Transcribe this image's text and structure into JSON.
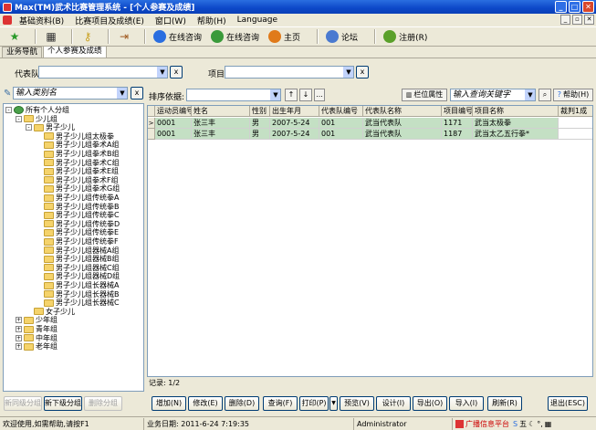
{
  "window": {
    "title": "Max(TM)武术比赛管理系统 - [个人参赛及成绩]"
  },
  "menu": {
    "items": [
      "基础资料(B)",
      "比赛项目及成绩(E)",
      "窗口(W)",
      "帮助(H)",
      "Language"
    ]
  },
  "toolbar": {
    "buttons": [
      {
        "label": "在线咨询",
        "icon": "headset-icon",
        "color": "#2a6ee0"
      },
      {
        "label": "在线咨询",
        "icon": "chat-icon",
        "color": "#3a9a3a"
      },
      {
        "label": "主页",
        "icon": "home-icon",
        "color": "#e07a1a"
      },
      {
        "label": "论坛",
        "icon": "forum-icon",
        "color": "#4a7ad0"
      },
      {
        "label": "注册(R)",
        "icon": "register-icon",
        "color": "#5aa02a"
      }
    ]
  },
  "tabs": [
    {
      "label": "业务导航",
      "active": false
    },
    {
      "label": "个人参赛及成绩",
      "active": true
    }
  ],
  "filters": {
    "team_label": "代表队",
    "team_value": "",
    "item_label": "项目",
    "item_value": "",
    "clear": "x"
  },
  "left": {
    "search_placeholder": "输入类别名",
    "clear": "x",
    "tree": [
      {
        "label": "所有个人分组",
        "level": 0,
        "expander": "-",
        "root": true
      },
      {
        "label": "少儿组",
        "level": 1,
        "expander": "-"
      },
      {
        "label": "男子少儿",
        "level": 2,
        "expander": "-"
      },
      {
        "label": "男子少儿组太极拳",
        "level": 3
      },
      {
        "label": "男子少儿组拳术A组",
        "level": 3
      },
      {
        "label": "男子少儿组拳术B组",
        "level": 3
      },
      {
        "label": "男子少儿组拳术C组",
        "level": 3
      },
      {
        "label": "男子少儿组拳术E组",
        "level": 3
      },
      {
        "label": "男子少儿组拳术F组",
        "level": 3
      },
      {
        "label": "男子少儿组拳术G组",
        "level": 3
      },
      {
        "label": "男子少儿组传统拳A",
        "level": 3
      },
      {
        "label": "男子少儿组传统拳B",
        "level": 3
      },
      {
        "label": "男子少儿组传统拳C",
        "level": 3
      },
      {
        "label": "男子少儿组传统拳D",
        "level": 3
      },
      {
        "label": "男子少儿组传统拳E",
        "level": 3
      },
      {
        "label": "男子少儿组传统拳F",
        "level": 3
      },
      {
        "label": "男子少儿组器械A组",
        "level": 3
      },
      {
        "label": "男子少儿组器械B组",
        "level": 3
      },
      {
        "label": "男子少儿组器械C组",
        "level": 3
      },
      {
        "label": "男子少儿组器械D组",
        "level": 3
      },
      {
        "label": "男子少儿组长器械A",
        "level": 3
      },
      {
        "label": "男子少儿组长器械B",
        "level": 3
      },
      {
        "label": "男子少儿组长器械C",
        "level": 3
      },
      {
        "label": "女子少儿",
        "level": 2
      },
      {
        "label": "少年组",
        "level": 1,
        "expander": "+"
      },
      {
        "label": "青年组",
        "level": 1,
        "expander": "+"
      },
      {
        "label": "中年组",
        "level": 1,
        "expander": "+"
      },
      {
        "label": "老年组",
        "level": 1,
        "expander": "+"
      }
    ],
    "buttons": {
      "add_sibling": "新同级分组",
      "add_child": "新下级分组",
      "delete": "删除分组"
    }
  },
  "right": {
    "sort_label": "排序依据:",
    "sort_value": "",
    "more": "...",
    "column_props": "栏位属性",
    "search_placeholder": "输入查询关键字",
    "help": "帮助(H)",
    "columns": [
      "运动员编号",
      "姓名",
      "性别",
      "出生年月",
      "代表队编号",
      "代表队名称",
      "项目编号",
      "项目名称",
      "裁判1成"
    ],
    "rows": [
      [
        "0001",
        "张三丰",
        "男",
        "2007-5-24",
        "001",
        "武当代表队",
        "1171",
        "武当太极拳",
        ""
      ],
      [
        "0001",
        "张三丰",
        "男",
        "2007-5-24",
        "001",
        "武当代表队",
        "1187",
        "武当太乙五行拳*",
        ""
      ]
    ],
    "current_row_marker": ">",
    "record_info": "记录: 1/2"
  },
  "actions": [
    "增加(N)",
    "修改(E)",
    "删除(D)",
    "查询(F)",
    "打印(P)",
    "预览(V)",
    "设计(I)",
    "导出(O)",
    "导入(I)",
    "刷新(R)",
    "退出(ESC)"
  ],
  "status": {
    "welcome": "欢迎使用,如需帮助,请按F1",
    "date": "业务日期: 2011-6-24 7:19:35",
    "user": "Administrator",
    "tray_text": "广播信息平台"
  }
}
